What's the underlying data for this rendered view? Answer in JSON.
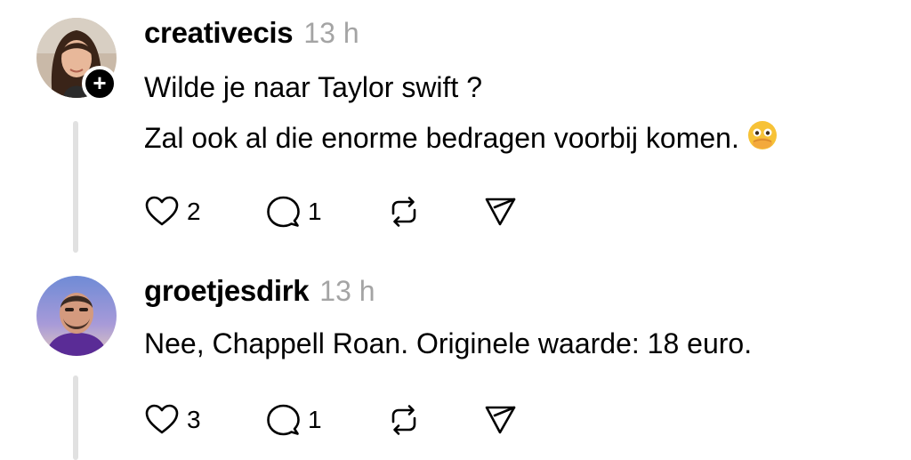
{
  "posts": [
    {
      "username": "creativecis",
      "time": "13 h",
      "lines": [
        "Wilde je naar Taylor swift ?",
        "Zal ook al die enorme bedragen voorbij komen."
      ],
      "emoji": "face-with-hand-over-mouth",
      "likes": "2",
      "replies": "1"
    },
    {
      "username": "groetjesdirk",
      "time": "13 h",
      "lines": [
        "Nee, Chappell Roan. Originele waarde: 18 euro."
      ],
      "likes": "3",
      "replies": "1"
    }
  ],
  "icons": {
    "follow": "plus-icon",
    "like": "heart-icon",
    "reply": "comment-icon",
    "repost": "repost-icon",
    "share": "send-icon"
  },
  "colors": {
    "time": "#a4a4a4",
    "thread_line": "#e1e1e1"
  }
}
